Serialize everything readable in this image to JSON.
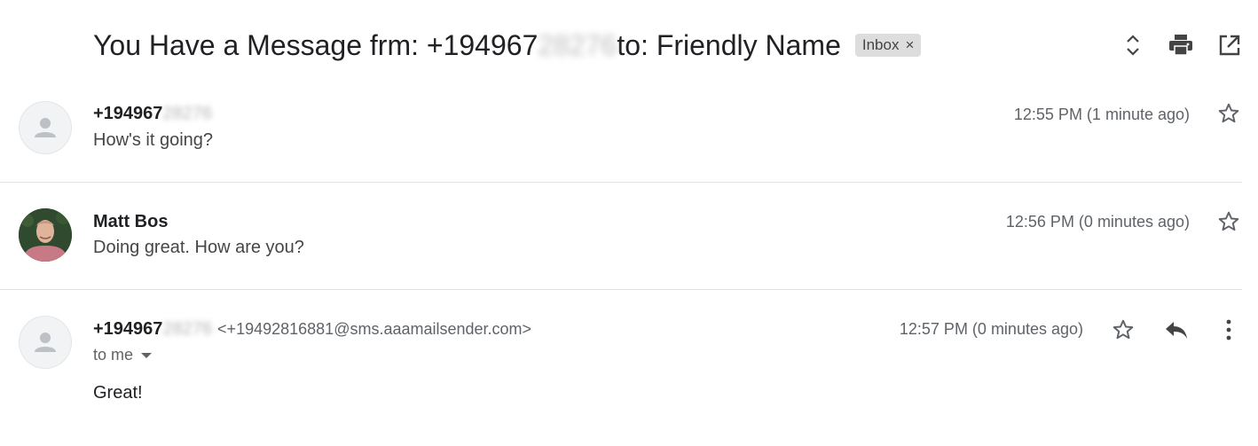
{
  "thread": {
    "subject_prefix": "You Have a Message frm: +194967",
    "subject_hidden": "28276",
    "subject_suffix": " to: Friendly Name",
    "label_chip": "Inbox",
    "label_remove": "×"
  },
  "toolbar_icons": [
    "expand-collapse-icon",
    "print-icon",
    "open-in-new-window-icon"
  ],
  "messages": [
    {
      "sender_visible": "+194967",
      "sender_hidden": "28276",
      "snippet": "How's it going?",
      "time": "12:55 PM (1 minute ago)",
      "avatar": "default-person",
      "starred": false
    },
    {
      "sender_visible": "Matt Bos",
      "snippet": "Doing great. How are you?",
      "time": "12:56 PM (0 minutes ago)",
      "avatar": "photo",
      "starred": false
    },
    {
      "sender_visible": "+194967",
      "sender_hidden": "28276",
      "email": "<+19492816881@sms.aaamailsender.com>",
      "recipient": "to me",
      "body": "Great!",
      "time": "12:57 PM (0 minutes ago)",
      "avatar": "default-person",
      "starred": false
    }
  ],
  "colors": {
    "text_primary": "#202124",
    "text_secondary": "#5f6368",
    "chip_bg": "#dddddd",
    "divider": "#e3e3e3"
  }
}
